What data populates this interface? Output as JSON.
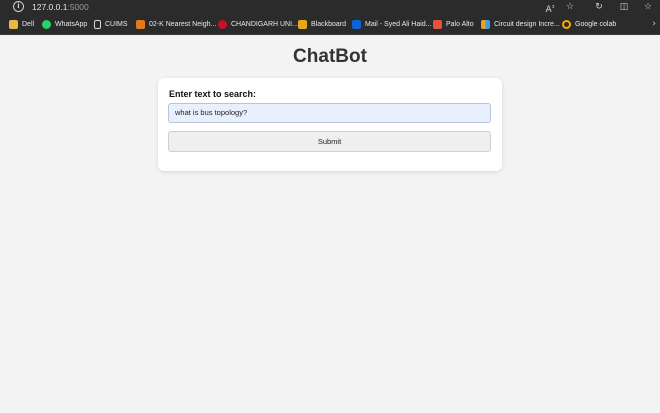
{
  "browser": {
    "url_host": "127.0.0.1",
    "url_port": ":5000",
    "toolbar_icons": [
      "info-icon",
      "read-aloud-icon",
      "favorite-icon",
      "extensions-icon",
      "split-screen-icon",
      "favorites-icon"
    ],
    "bookmarks": [
      {
        "label": "Dell",
        "icon": "folder-icon",
        "color": "#e8b84a"
      },
      {
        "label": "WhatsApp",
        "icon": "whatsapp-icon",
        "color": "#25d366"
      },
      {
        "label": "CUIMS",
        "icon": "document-icon",
        "color": "#d8d8d8"
      },
      {
        "label": "02-K Nearest Neigh...",
        "icon": "notebook-icon",
        "color": "#e07b1a"
      },
      {
        "label": "CHANDIGARH UNI...",
        "icon": "university-icon",
        "color": "#c8102e"
      },
      {
        "label": "Blackboard",
        "icon": "blackboard-icon",
        "color": "#e6a817"
      },
      {
        "label": "Mail - Syed Ali Haid...",
        "icon": "outlook-icon",
        "color": "#0a64d8"
      },
      {
        "label": "Palo Alto",
        "icon": "palo-alto-icon",
        "color": "#e5533d"
      },
      {
        "label": "Circuit design Incre...",
        "icon": "grid-icon",
        "color": "#f0a020"
      },
      {
        "label": "Google colab",
        "icon": "colab-icon",
        "color": "#f9ab00"
      }
    ]
  },
  "page": {
    "title": "ChatBot",
    "form_label": "Enter text to search:",
    "input_value": "what is bus topology?",
    "submit_label": "Submit"
  }
}
